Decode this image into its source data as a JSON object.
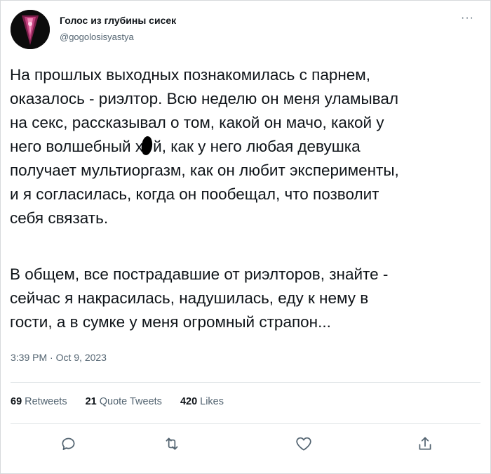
{
  "user": {
    "name": "Голос из глубины сисек",
    "handle": "@gogolosisyastya"
  },
  "tweet": {
    "paragraph1": [
      "На прошлых выходных познакомилась с парнем,",
      "оказалось - риэлтор. Всю неделю он меня уламывал",
      "на секс, рассказывал о том, какой он мачо, какой у"
    ],
    "line4_before": "него волшебный х",
    "line4_after": "й, как у него любая девушка",
    "paragraph1_rest": [
      "получает мультиоргазм, как он любит эксперименты,",
      "и я согласилась, когда он пообещал, что позволит",
      "себя связать."
    ],
    "paragraph2": [
      "В общем, все пострадавшие от риэлторов, знайте -",
      "сейчас я накрасилась, надушилась, еду к нему в",
      "гости, а в сумке у меня огромный страпон..."
    ],
    "timestamp": "3:39 PM · Oct 9, 2023"
  },
  "stats": {
    "retweets_count": "69",
    "retweets_label": "Retweets",
    "quotes_count": "21",
    "quotes_label": "Quote Tweets",
    "likes_count": "420",
    "likes_label": "Likes"
  },
  "icons": [
    "more-icon",
    "reply-icon",
    "retweet-icon",
    "like-icon",
    "share-icon"
  ]
}
